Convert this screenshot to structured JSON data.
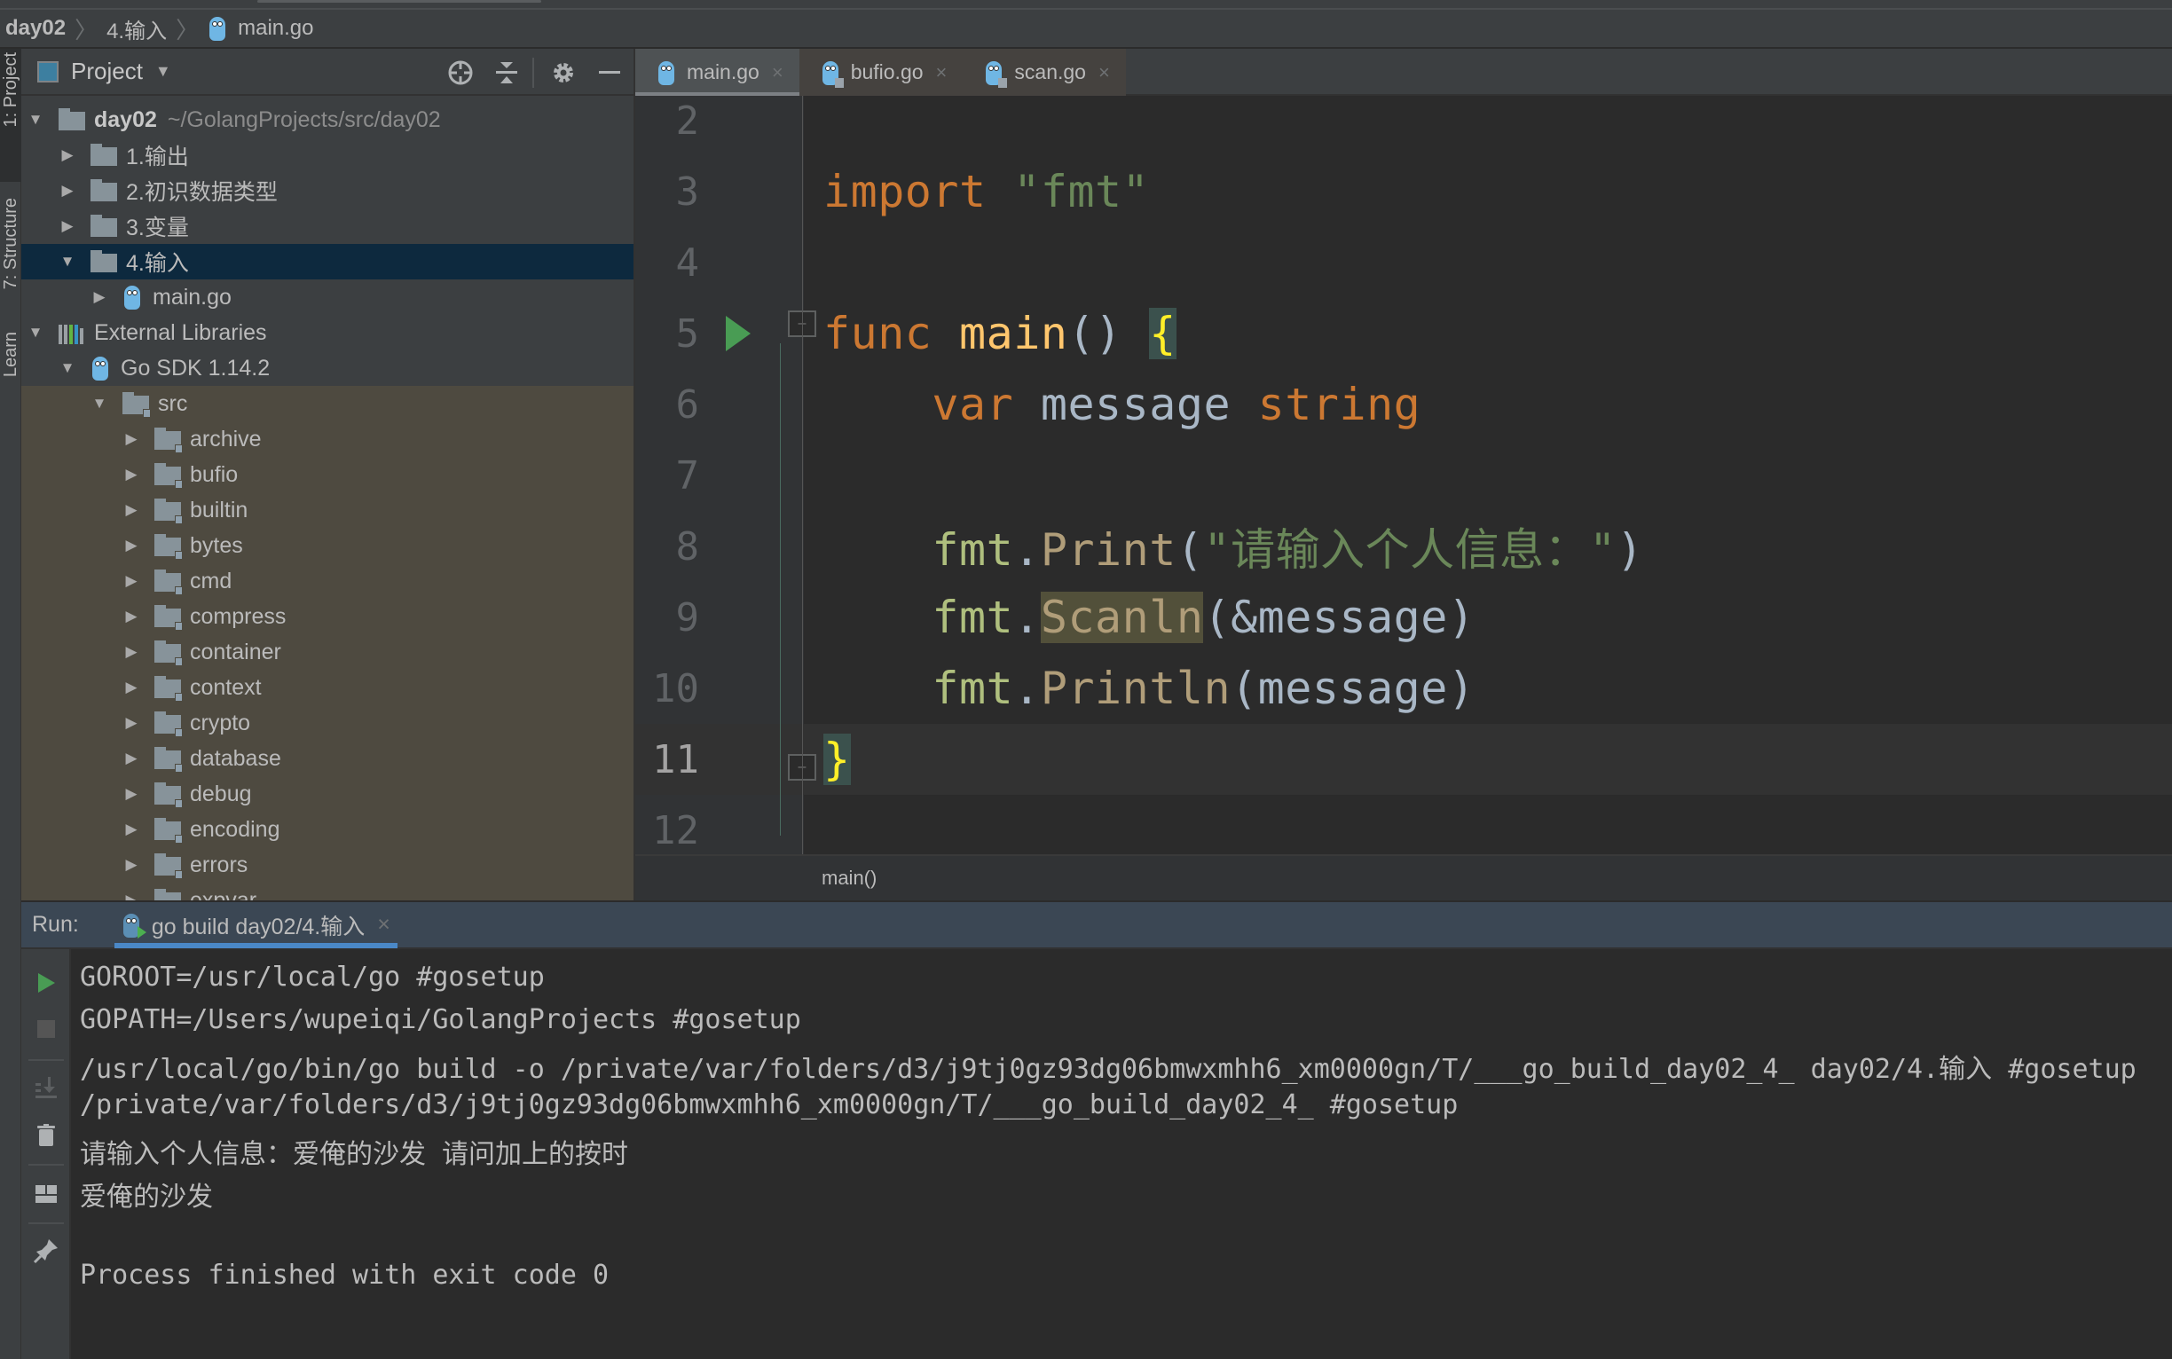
{
  "navbar": {
    "crumbs": [
      "day02",
      "4.输入",
      "main.go"
    ]
  },
  "toolstrip": {
    "tabs": [
      "1: Project",
      "7: Structure",
      "Learn"
    ]
  },
  "project_panel": {
    "title": "Project",
    "icons": [
      "locate-icon",
      "collapse-all-icon",
      "gear-icon",
      "hide-icon"
    ],
    "tree": [
      {
        "label": "day02",
        "path": "~/GolangProjects/src/day02",
        "expanded": true,
        "level": 0,
        "type": "folder",
        "bold": true
      },
      {
        "label": "1.输出",
        "expanded": false,
        "level": 1,
        "type": "folder"
      },
      {
        "label": "2.初识数据类型",
        "expanded": false,
        "level": 1,
        "type": "folder"
      },
      {
        "label": "3.变量",
        "expanded": false,
        "level": 1,
        "type": "folder"
      },
      {
        "label": "4.输入",
        "expanded": true,
        "level": 1,
        "type": "folder",
        "selected": true
      },
      {
        "label": "main.go",
        "expanded": false,
        "level": 2,
        "type": "gofile"
      },
      {
        "label": "External Libraries",
        "expanded": true,
        "level": 0,
        "type": "library"
      },
      {
        "label": "Go SDK 1.14.2",
        "expanded": true,
        "level": 1,
        "type": "sdk"
      },
      {
        "label": "src",
        "expanded": true,
        "level": 2,
        "type": "lockfolder"
      },
      {
        "label": "archive",
        "expanded": false,
        "level": 3,
        "type": "lockfolder"
      },
      {
        "label": "bufio",
        "expanded": false,
        "level": 3,
        "type": "lockfolder"
      },
      {
        "label": "builtin",
        "expanded": false,
        "level": 3,
        "type": "lockfolder"
      },
      {
        "label": "bytes",
        "expanded": false,
        "level": 3,
        "type": "lockfolder"
      },
      {
        "label": "cmd",
        "expanded": false,
        "level": 3,
        "type": "lockfolder"
      },
      {
        "label": "compress",
        "expanded": false,
        "level": 3,
        "type": "lockfolder"
      },
      {
        "label": "container",
        "expanded": false,
        "level": 3,
        "type": "lockfolder"
      },
      {
        "label": "context",
        "expanded": false,
        "level": 3,
        "type": "lockfolder"
      },
      {
        "label": "crypto",
        "expanded": false,
        "level": 3,
        "type": "lockfolder"
      },
      {
        "label": "database",
        "expanded": false,
        "level": 3,
        "type": "lockfolder"
      },
      {
        "label": "debug",
        "expanded": false,
        "level": 3,
        "type": "lockfolder"
      },
      {
        "label": "encoding",
        "expanded": false,
        "level": 3,
        "type": "lockfolder"
      },
      {
        "label": "errors",
        "expanded": false,
        "level": 3,
        "type": "lockfolder"
      },
      {
        "label": "expvar",
        "expanded": false,
        "level": 3,
        "type": "lockfolder"
      }
    ]
  },
  "editor": {
    "tabs": [
      {
        "label": "main.go",
        "active": true,
        "readonly": false
      },
      {
        "label": "bufio.go",
        "active": false,
        "readonly": true
      },
      {
        "label": "scan.go",
        "active": false,
        "readonly": true
      }
    ],
    "current_line": 11,
    "lines": [
      {
        "n": "2",
        "tokens": []
      },
      {
        "n": "3",
        "tokens": [
          [
            "kw",
            "import"
          ],
          [
            "",
            " "
          ],
          [
            "str",
            "\"fmt\""
          ]
        ]
      },
      {
        "n": "4",
        "tokens": []
      },
      {
        "n": "5",
        "run": true,
        "fold": "open",
        "tokens": [
          [
            "kw",
            "func"
          ],
          [
            "",
            " "
          ],
          [
            "fn",
            "main"
          ],
          [
            "",
            "() "
          ],
          [
            "brace",
            "{"
          ]
        ]
      },
      {
        "n": "6",
        "tokens": [
          [
            "",
            "    "
          ],
          [
            "kw",
            "var"
          ],
          [
            "",
            " message "
          ],
          [
            "kw",
            "string"
          ]
        ]
      },
      {
        "n": "7",
        "tokens": []
      },
      {
        "n": "8",
        "tokens": [
          [
            "",
            "    "
          ],
          [
            "pkg",
            "fmt"
          ],
          [
            "",
            "."
          ],
          [
            "call",
            "Print"
          ],
          [
            "",
            "("
          ],
          [
            "str",
            "\"请输入个人信息：\""
          ],
          [
            "",
            ")"
          ]
        ]
      },
      {
        "n": "9",
        "tokens": [
          [
            "",
            "    "
          ],
          [
            "pkg",
            "fmt"
          ],
          [
            "",
            "."
          ],
          [
            "call hl",
            "Scanln"
          ],
          [
            "",
            "(&message)"
          ]
        ]
      },
      {
        "n": "10",
        "tokens": [
          [
            "",
            "    "
          ],
          [
            "pkg",
            "fmt"
          ],
          [
            "",
            "."
          ],
          [
            "call",
            "Println"
          ],
          [
            "",
            "(message)"
          ]
        ]
      },
      {
        "n": "11",
        "fold": "close",
        "tokens": [
          [
            "brace",
            "}"
          ]
        ]
      },
      {
        "n": "12",
        "tokens": []
      }
    ],
    "breadcrumb": "main()"
  },
  "run_panel": {
    "label": "Run:",
    "tab_label": "go build day02/4.输入",
    "tools": [
      "rerun-icon",
      "stop-icon",
      "scroll-to-end-icon",
      "clear-icon",
      "layout-icon",
      "pin-icon"
    ],
    "output": [
      "GOROOT=/usr/local/go #gosetup",
      "GOPATH=/Users/wupeiqi/GolangProjects #gosetup",
      "/usr/local/go/bin/go build -o /private/var/folders/d3/j9tj0gz93dg06bmwxmhh6_xm0000gn/T/___go_build_day02_4_ day02/4.输入 #gosetup",
      "/private/var/folders/d3/j9tj0gz93dg06bmwxmhh6_xm0000gn/T/___go_build_day02_4_ #gosetup",
      "请输入个人信息：爱俺的沙发 请问加上的按时",
      "爱俺的沙发",
      "",
      "Process finished with exit code 0"
    ]
  },
  "colors": {
    "keyword": "#cc7832",
    "string": "#6a8759",
    "function": "#ffc66d",
    "selection": "#0d293e",
    "run_green": "#499c54",
    "accent_blue": "#4a88c7"
  }
}
